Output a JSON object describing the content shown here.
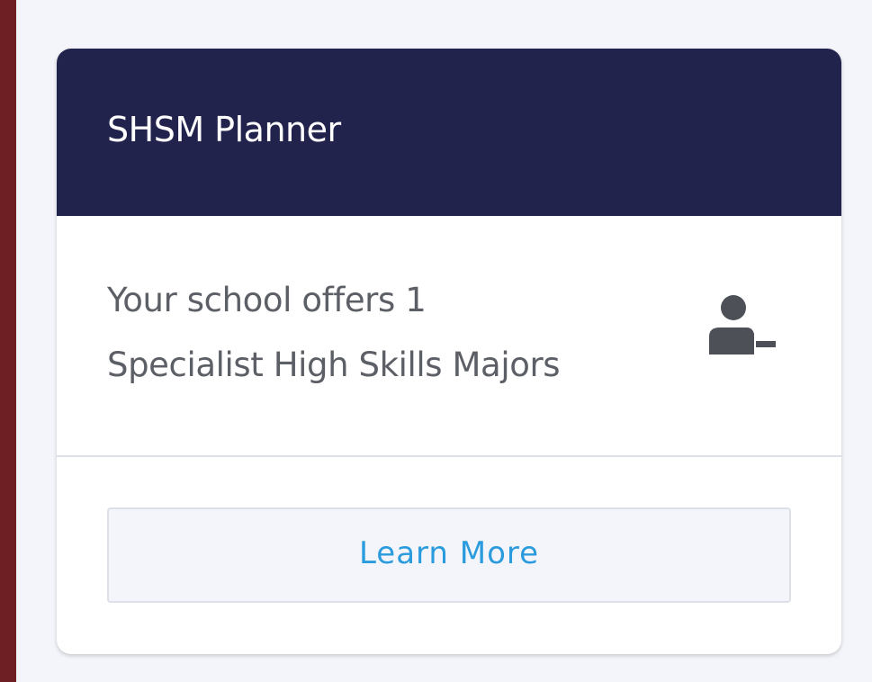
{
  "card": {
    "title": "SHSM Planner",
    "body_line_1": "Your school offers 1",
    "body_line_2": "Specialist High Skills Majors",
    "icon": "person-remove-icon",
    "button_label": "Learn More"
  },
  "colors": {
    "page_background": "#6e1f24",
    "panel_background": "#f4f5fa",
    "header_background": "#22234d",
    "button_text": "#2a9bdc",
    "body_text": "#5c6066"
  }
}
